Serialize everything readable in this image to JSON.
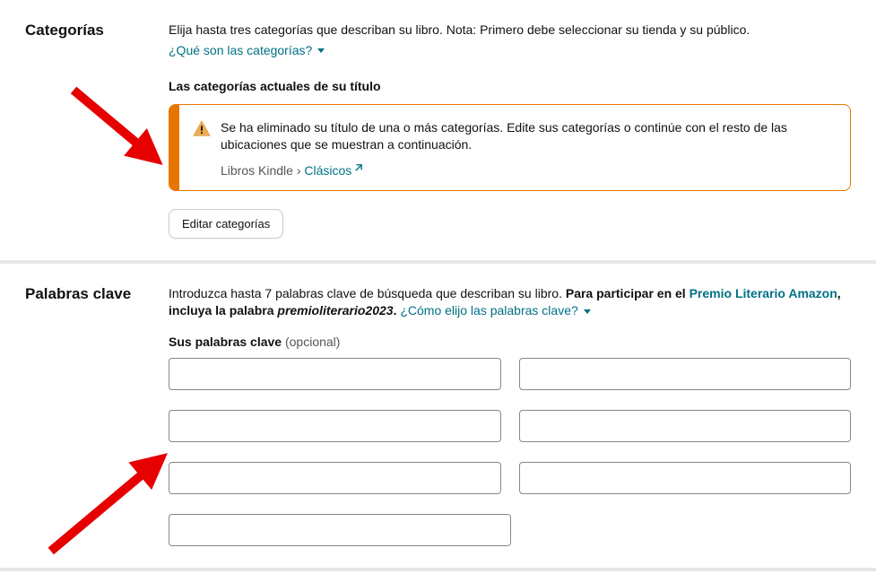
{
  "categories": {
    "heading": "Categorías",
    "description": "Elija hasta tres categorías que describan su libro. Nota: Primero debe seleccionar su tienda y su público.",
    "help_link": "¿Qué son las categorías?",
    "current_label": "Las categorías actuales de su título",
    "alert": {
      "text": "Se ha eliminado su título de una o más categorías. Edite sus categorías o continúe con el resto de las ubicaciones que se muestran a continuación.",
      "path_prefix": "Libros Kindle",
      "path_separator": " › ",
      "path_link": "Clásicos"
    },
    "edit_button": "Editar categorías"
  },
  "keywords": {
    "heading": "Palabras clave",
    "desc_part1": "Introduzca hasta 7 palabras clave de búsqueda que describan su libro. ",
    "desc_bold1": "Para participar en el ",
    "premio_link": "Premio Literario Amazon",
    "desc_bold2": ", incluya la palabra ",
    "desc_italic": "premioliterario2023",
    "desc_period": ". ",
    "help_link": "¿Cómo elijo las palabras clave?",
    "label": "Sus palabras clave",
    "optional": " (opcional)",
    "values": [
      "",
      "",
      "",
      "",
      "",
      "",
      ""
    ]
  }
}
